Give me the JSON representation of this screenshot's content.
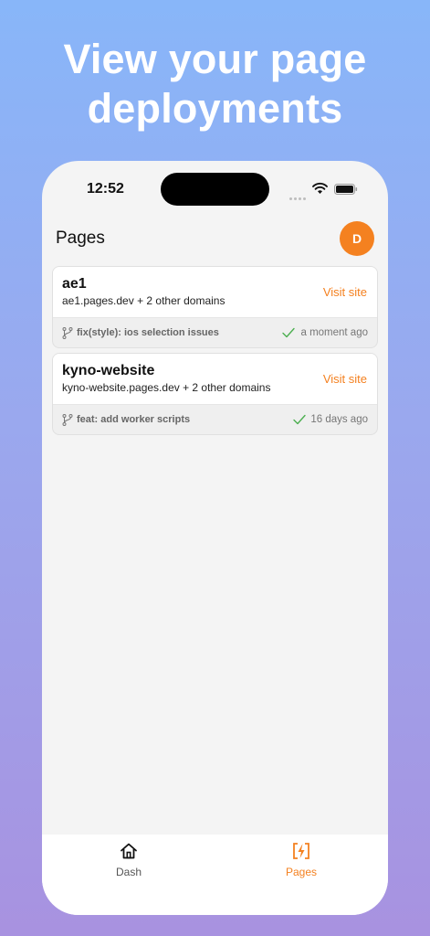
{
  "headline": {
    "line1": "View your page",
    "line2": "deployments"
  },
  "statusbar": {
    "time": "12:52"
  },
  "app": {
    "title": "Pages",
    "avatar_initial": "D"
  },
  "projects": [
    {
      "name": "ae1",
      "domains": "ae1.pages.dev + 2 other domains",
      "visit_label": "Visit site",
      "commit": "fix(style): ios selection issues",
      "status": "success",
      "time_ago": "a moment ago"
    },
    {
      "name": "kyno-website",
      "domains": "kyno-website.pages.dev + 2 other domains",
      "visit_label": "Visit site",
      "commit": "feat: add worker scripts",
      "status": "success",
      "time_ago": "16 days ago"
    }
  ],
  "tabbar": {
    "tabs": [
      {
        "label": "Dash",
        "icon": "home-icon",
        "active": false
      },
      {
        "label": "Pages",
        "icon": "lightning-bolt-icon",
        "active": true
      }
    ]
  },
  "colors": {
    "accent": "#f48120",
    "success": "#4caf50",
    "inactive_tab": "#555555"
  }
}
